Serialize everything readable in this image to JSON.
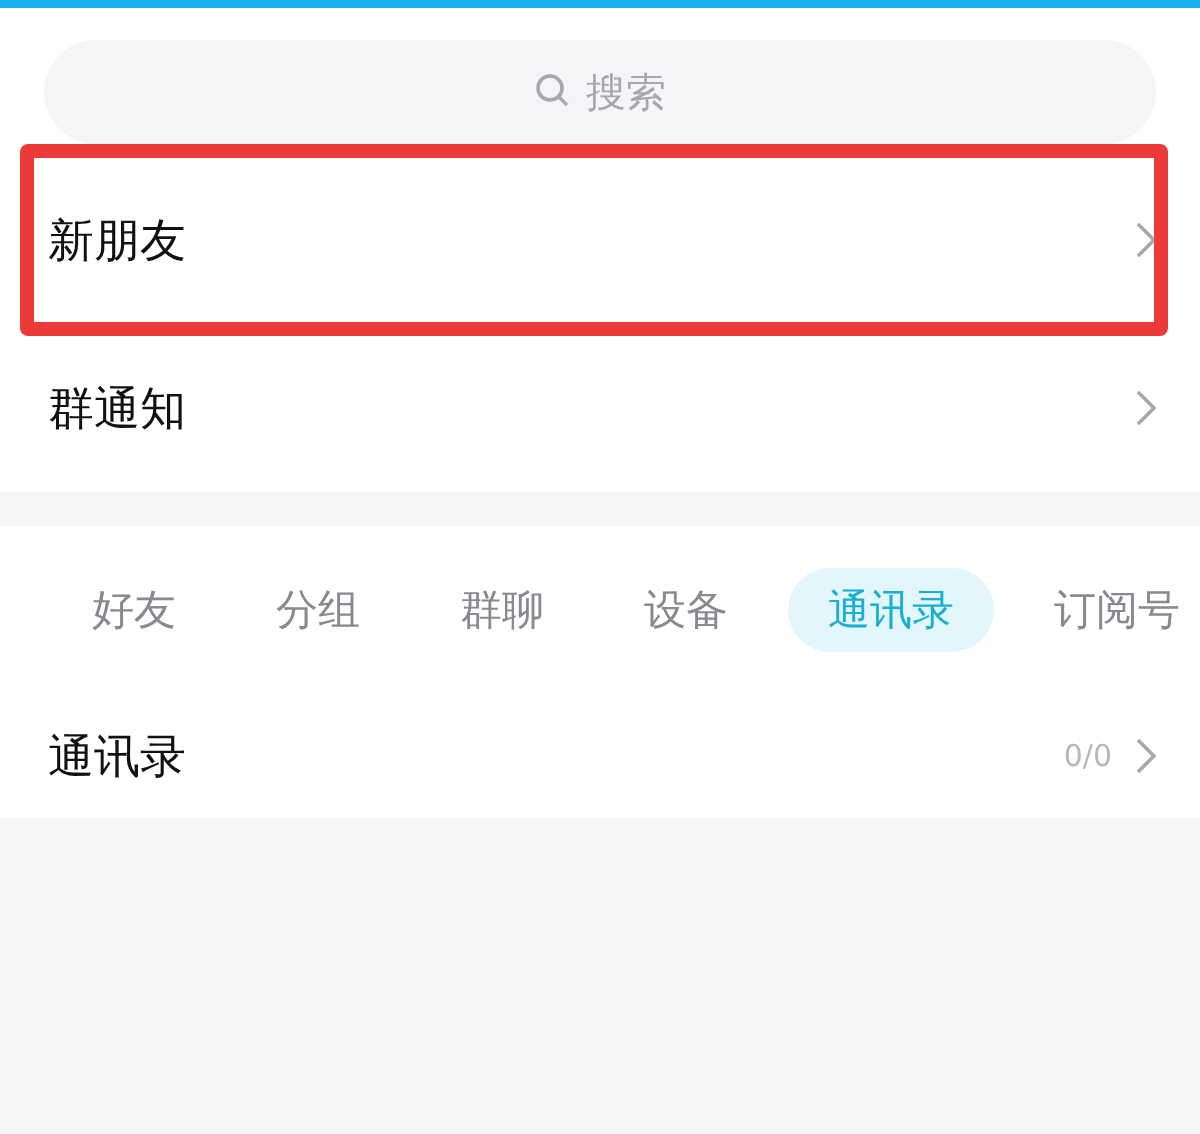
{
  "search": {
    "placeholder": "搜索"
  },
  "entries": [
    {
      "label": "新朋友",
      "highlighted": true
    },
    {
      "label": "群通知",
      "highlighted": false
    }
  ],
  "tabs": [
    {
      "label": "好友",
      "selected": false
    },
    {
      "label": "分组",
      "selected": false
    },
    {
      "label": "群聊",
      "selected": false
    },
    {
      "label": "设备",
      "selected": false
    },
    {
      "label": "通讯录",
      "selected": true
    },
    {
      "label": "订阅号",
      "selected": false
    }
  ],
  "list": [
    {
      "label": "通讯录",
      "count": "0/0"
    }
  ]
}
